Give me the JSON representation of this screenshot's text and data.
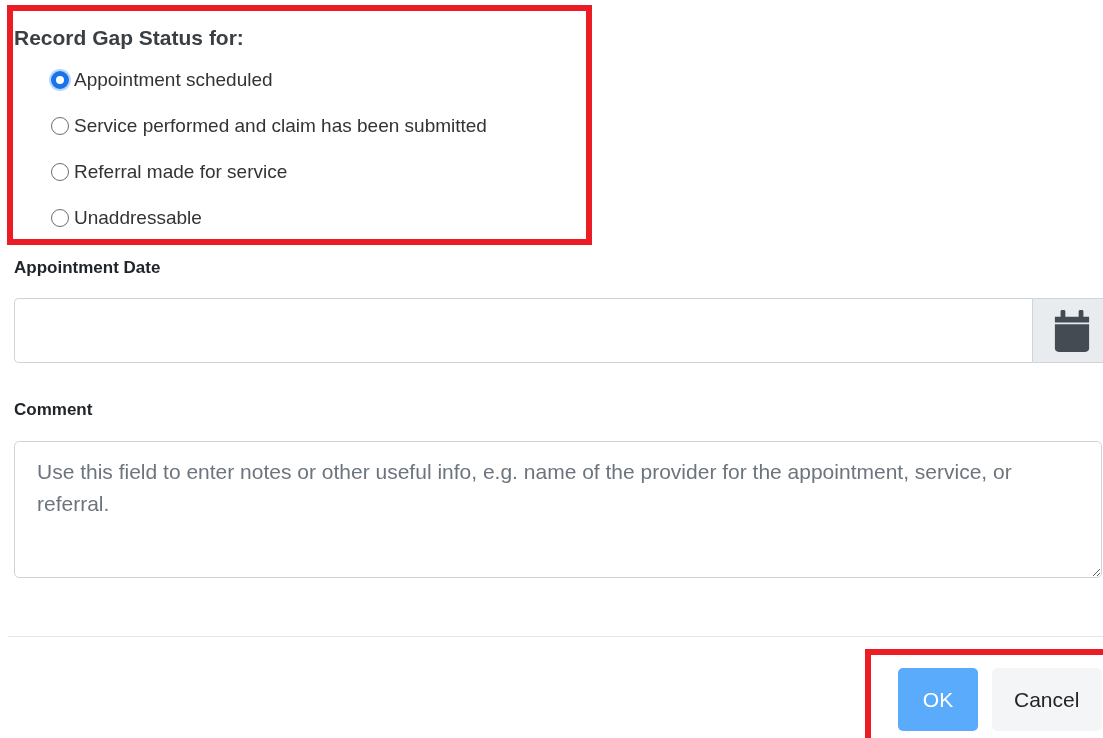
{
  "heading": "Record Gap Status for:",
  "options": [
    {
      "label": "Appointment scheduled",
      "selected": true
    },
    {
      "label": "Service performed and claim has been submitted",
      "selected": false
    },
    {
      "label": "Referral made for service",
      "selected": false
    },
    {
      "label": "Unaddressable",
      "selected": false
    }
  ],
  "date_field": {
    "label": "Appointment Date"
  },
  "comment_field": {
    "label": "Comment",
    "placeholder": "Use this field to enter notes or other useful info, e.g. name of the provider for the appointment, service, or referral."
  },
  "buttons": [
    {
      "label": "OK",
      "kind": "primary"
    },
    {
      "label": "Cancel",
      "kind": "secondary"
    }
  ]
}
